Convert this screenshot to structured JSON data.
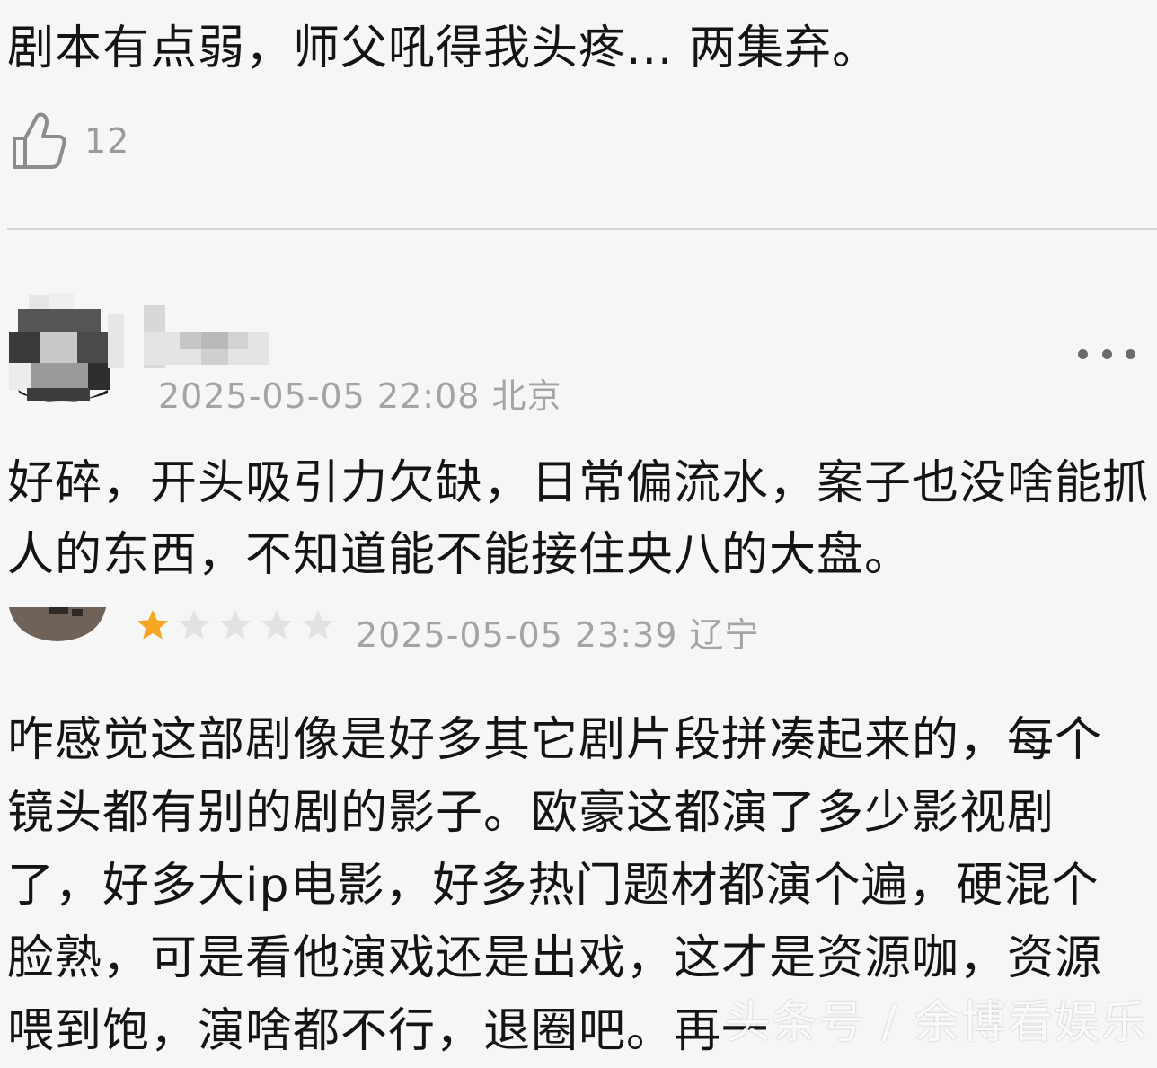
{
  "comments": [
    {
      "text": "剧本有点弱，师父吼得我头疼... 两集弃。",
      "likes": "12"
    },
    {
      "timestamp": "2025-05-05 22:08 北京",
      "text": "好碎，开头吸引力欠缺，日常偏流水，案子也没啥能抓人的东西，不知道能不能接住央八的大盘。"
    },
    {
      "rating": 1,
      "rating_max": 5,
      "timestamp": "2025-05-05 23:39 辽宁",
      "text": "咋感觉这部剧像是好多其它剧片段拼凑起来的，每个镜头都有别的剧的影子。欧豪这都演了多少影视剧了，好多大ip电影，好多热门题材都演个遍，硬混个脸熟，可是看他演戏还是出戏，这才是资源咖，资源喂到饱，演啥都不行，退圈吧。再一"
    }
  ],
  "watermark": "头条号 / 余博看娱乐",
  "colors": {
    "star_filled": "#f5a623",
    "star_empty": "#e2e2e2",
    "meta_text": "#a4a4a4"
  },
  "icons": {
    "like": "thumbs-up-icon",
    "more": "more-dots-icon",
    "star": "star-icon"
  }
}
